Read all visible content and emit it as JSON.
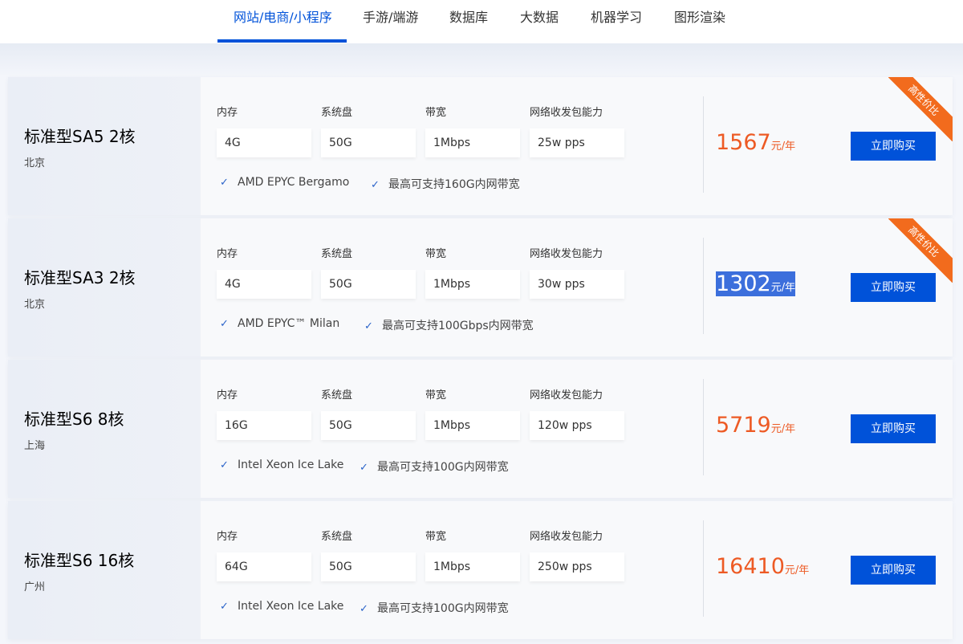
{
  "tabs": [
    {
      "label": "网站/电商/小程序",
      "active": true
    },
    {
      "label": "手游/端游"
    },
    {
      "label": "数据库"
    },
    {
      "label": "大数据"
    },
    {
      "label": "机器学习"
    },
    {
      "label": "图形渲染"
    }
  ],
  "spec_labels": [
    "内存",
    "系统盘",
    "带宽",
    "网络收发包能力"
  ],
  "buy_label": "立即购买",
  "price_unit": "元/年",
  "badge_label": "高性价比",
  "cards": [
    {
      "title": "标准型SA5 2核",
      "region": "北京",
      "specs": [
        "4G",
        "50G",
        "1Mbps",
        "25w pps"
      ],
      "features": [
        "AMD EPYC Bergamo",
        "最高可支持160G内网带宽"
      ],
      "price": "1567",
      "badge": true
    },
    {
      "title": "标准型SA3 2核",
      "region": "北京",
      "specs": [
        "4G",
        "50G",
        "1Mbps",
        "30w pps"
      ],
      "features": [
        "AMD EPYC™ Milan",
        "最高可支持100Gbps内网带宽"
      ],
      "price": "1302",
      "badge": true,
      "price_selected": true
    },
    {
      "title": "标准型S6 8核",
      "region": "上海",
      "specs": [
        "16G",
        "50G",
        "1Mbps",
        "120w pps"
      ],
      "features": [
        "Intel Xeon Ice Lake",
        "最高可支持100G内网带宽"
      ],
      "price": "5719",
      "badge": false
    },
    {
      "title": "标准型S6 16核",
      "region": "广州",
      "specs": [
        "64G",
        "50G",
        "1Mbps",
        "250w pps"
      ],
      "features": [
        "Intel Xeon Ice Lake",
        "最高可支持100G内网带宽"
      ],
      "price": "16410",
      "badge": false
    }
  ],
  "colors": {
    "accent": "#0052d9",
    "price": "#ed5a24",
    "badge": "#f26b1d"
  }
}
